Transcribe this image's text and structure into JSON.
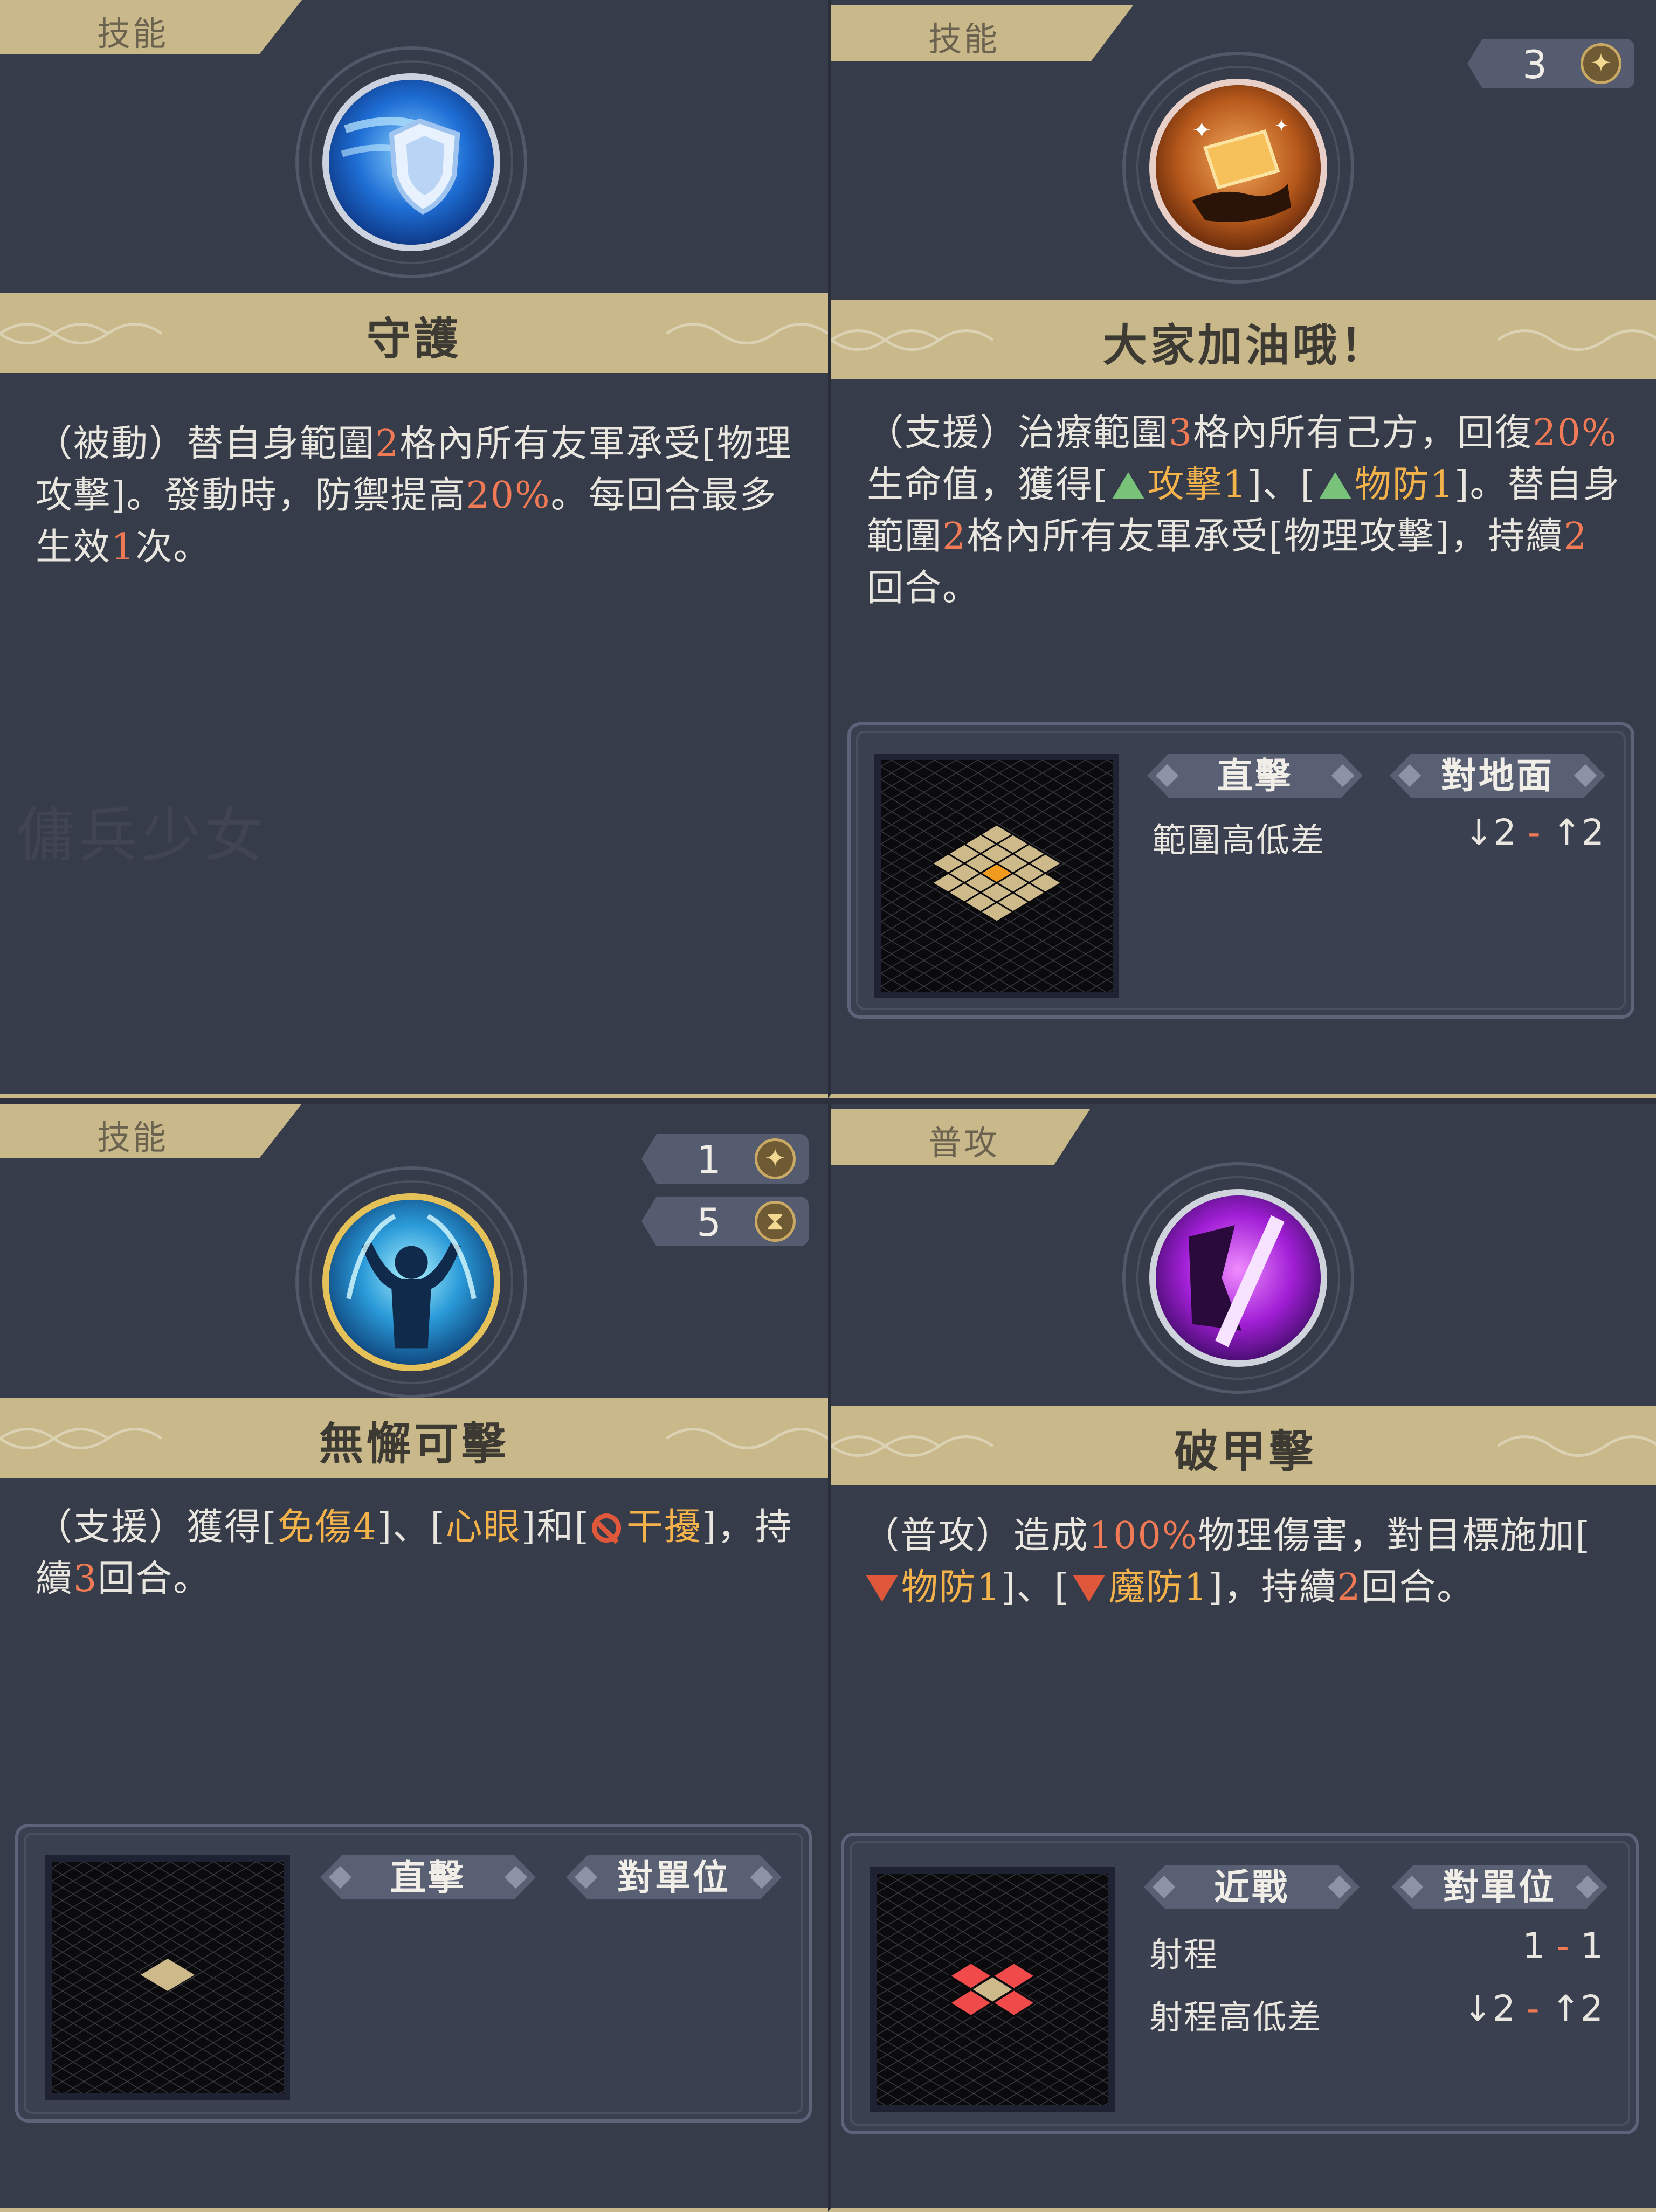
{
  "watermark": "傭兵少女",
  "cards": [
    {
      "tab": "技能",
      "name": "守護",
      "desc": {
        "p1": "（被動）替自身範圍",
        "n1": "2",
        "p2": "格內所有友軍承受[物理攻擊]。發動時，防禦提高",
        "n2": "20%",
        "p3": "。每回合最多生效",
        "n3": "1",
        "p4": "次。"
      },
      "icon": "shield-icon"
    },
    {
      "tab": "技能",
      "name": "大家加油哦！",
      "cost": "3",
      "cost_icon": "star-icon",
      "desc": {
        "p1": "（支援）治療範圍",
        "n1": "3",
        "p2": "格內所有己方，回復",
        "n2": "20%",
        "p3": "生命值，獲得[",
        "k1": "攻擊1",
        "p4": "]、[",
        "k2": "物防1",
        "p5": "]。替自身範圍",
        "n3": "2",
        "p6": "格內所有友軍承受[物理攻擊]，持續",
        "n4": "2",
        "p7": "回合。"
      },
      "icon": "hand-gold-icon",
      "range": {
        "tag1": "直擊",
        "tag2": "對地面",
        "stat1_label": "範圍高低差",
        "stat1_low": "↓2",
        "stat1_dash": " - ",
        "stat1_high": "↑2"
      }
    },
    {
      "tab": "技能",
      "name": "無懈可擊",
      "cost": "1",
      "cost_icon": "star-icon",
      "cooldown": "5",
      "cooldown_icon": "hourglass-icon",
      "desc": {
        "p1": "（支援）獲得[",
        "k1": "免傷4",
        "p2": "]、[",
        "k2": "心眼",
        "p3": "]和[",
        "k3": "干擾",
        "p4": "]，持續",
        "n1": "3",
        "p5": "回合。"
      },
      "icon": "body-aura-icon",
      "range": {
        "tag1": "直擊",
        "tag2": "對單位"
      }
    },
    {
      "tab": "普攻",
      "name": "破甲擊",
      "desc": {
        "p1": "（普攻）造成",
        "n1": "100%",
        "p2": "物理傷害，對目標施加[",
        "k1": "物防1",
        "p3": "]、[",
        "k2": "魔防1",
        "p4": "]，持續",
        "n2": "2",
        "p5": "回合。"
      },
      "icon": "slash-purple-icon",
      "range": {
        "tag1": "近戰",
        "tag2": "對單位",
        "stat1_label": "射程",
        "stat1_low": "1",
        "stat1_dash": " - ",
        "stat1_high": "1",
        "stat2_label": "射程高低差",
        "stat2_low": "↓2",
        "stat2_dash": " - ",
        "stat2_high": "↑2"
      }
    }
  ]
}
